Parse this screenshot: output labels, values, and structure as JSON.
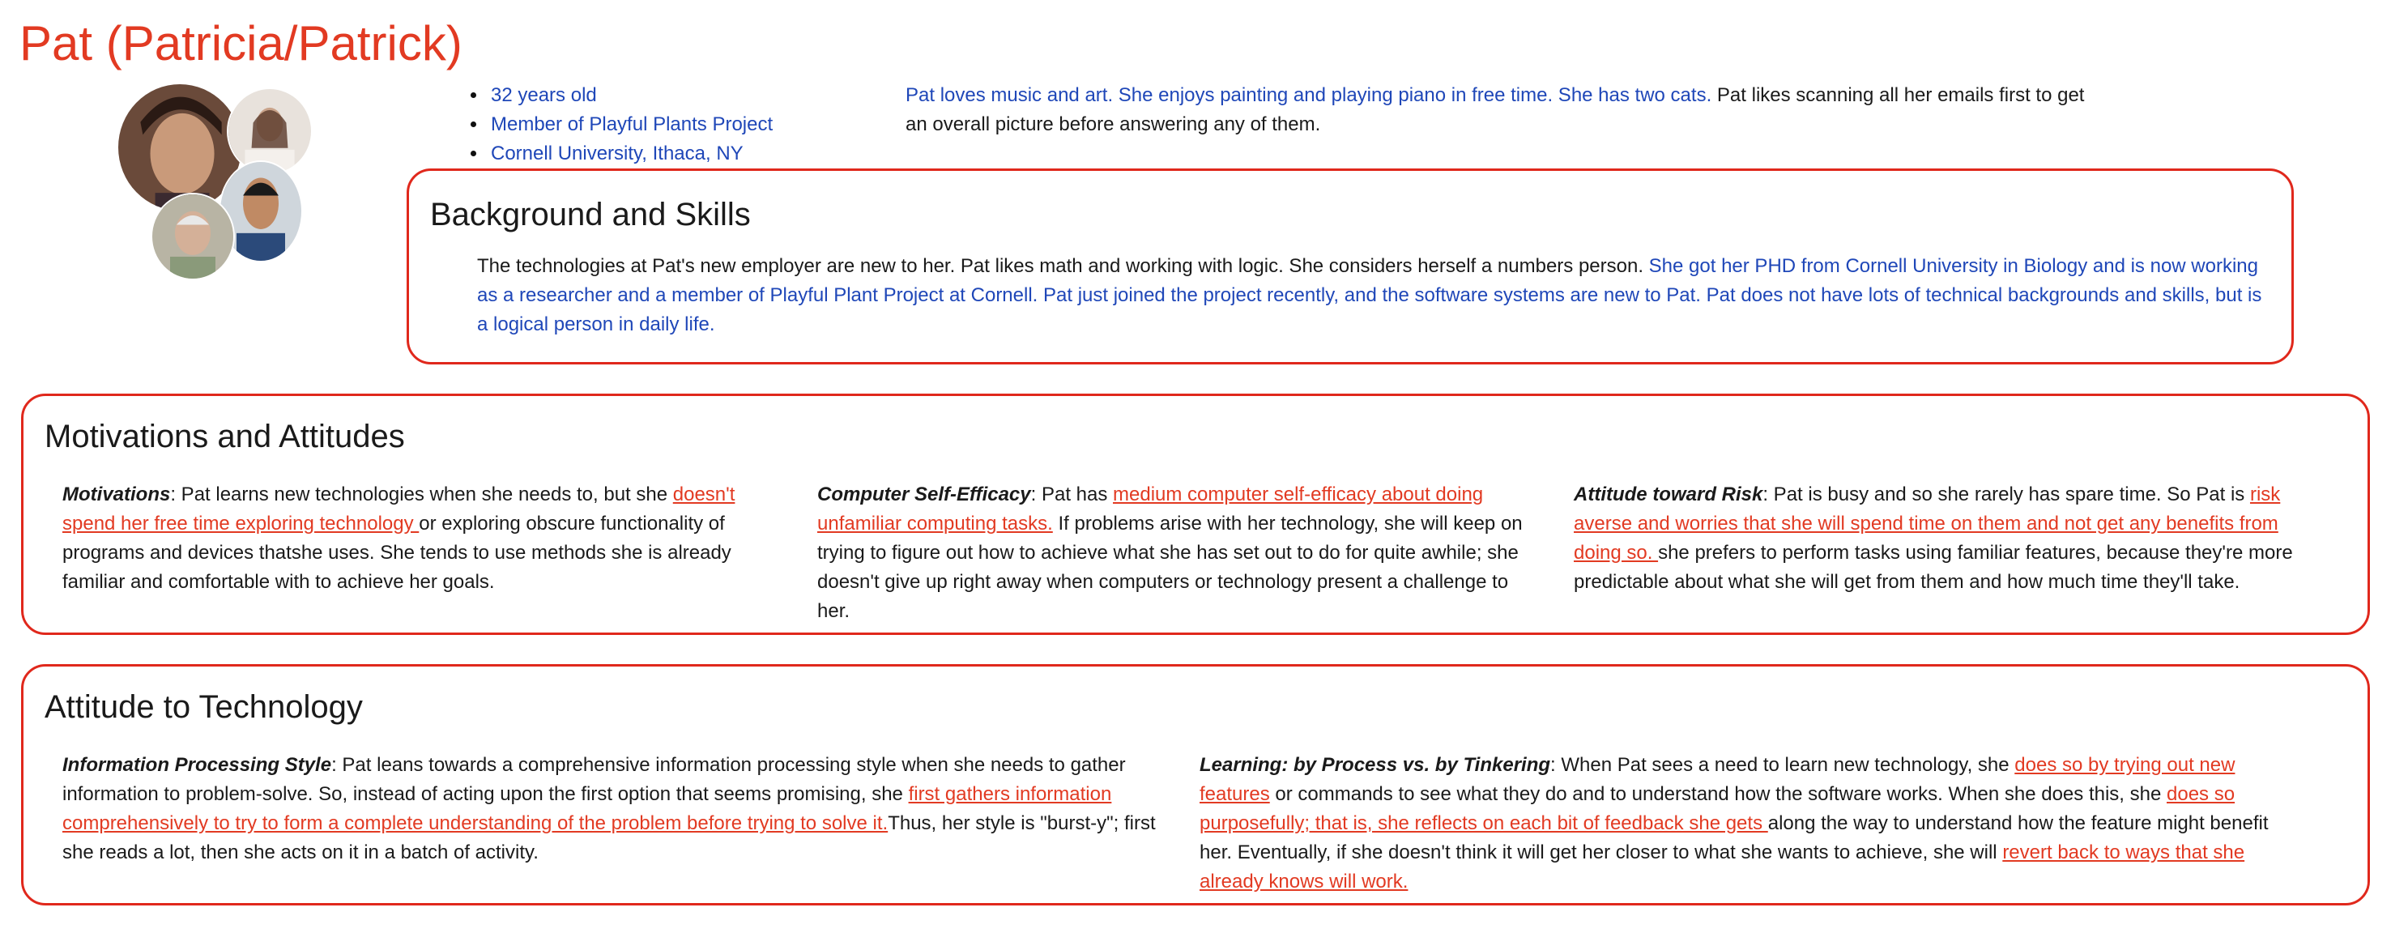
{
  "persona": {
    "name": "Pat (Patricia/Patrick)",
    "facts": [
      "32 years old",
      "Member of Playful Plants Project",
      "Cornell University, Ithaca, NY"
    ],
    "intro_blue": "Pat loves music and art. She enjoys painting and playing piano in free time. She has two cats.",
    "intro_rest": " Pat likes scanning all her emails first to get an overall picture before answering any of them."
  },
  "background": {
    "title": "Background and Skills",
    "text_plain": "The technologies at Pat's new employer are new to her. Pat likes math and working with logic. She considers herself a numbers person. ",
    "text_blue": "She got her PHD from Cornell University in Biology and is now working as a researcher and a member of Playful Plant Project at Cornell. Pat just joined the project recently, and the software systems are new to Pat. Pat does not have lots of technical backgrounds and skills, but is a logical person in daily life."
  },
  "motivations": {
    "title": "Motivations and Attitudes",
    "motivations": {
      "label": "Motivations",
      "a": ": Pat learns new technologies when she needs to, but she ",
      "link": "doesn't spend her free time exploring technology ",
      "b": "or exploring obscure functionality of programs and devices thatshe uses. She tends to use methods she is already familiar and comfortable with to achieve her goals."
    },
    "efficacy": {
      "label": "Computer Self-Efficacy",
      "a": ": Pat has ",
      "link": "medium computer self-efficacy about doing unfamiliar computing tasks.",
      "b": " If problems arise with her technology, she will keep on trying to figure out how to achieve what she has set out to do for quite awhile; she doesn't give up right away when computers or technology present a challenge to her."
    },
    "risk": {
      "label": "Attitude toward Risk",
      "a": ": Pat is busy and so she rarely has spare time. So Pat is ",
      "link": "risk averse and worries that she will spend time on them and not get any benefits from doing so. ",
      "b": "she prefers to perform tasks using familiar features, because they're more predictable about what she will get from them and how much time they'll take."
    }
  },
  "technology": {
    "title": "Attitude to Technology",
    "info": {
      "label": "Information Processing Style",
      "a": ": Pat leans towards a comprehensive information processing style when she needs to gather information to problem-solve. So, instead of acting upon the first option that seems promising, she ",
      "link": "first gathers information comprehensively to try to form a complete understanding of the problem before trying to solve it.",
      "b": "Thus, her style is \"burst-y\"; first she reads a lot, then she acts on it in a batch of activity."
    },
    "learning": {
      "label": "Learning: by Process vs. by Tinkering",
      "a": ": When Pat sees a need to learn new technology, she ",
      "link1": "does so by trying out new features",
      "b": " or commands to see what they do and to understand how the software works. When she does this, she ",
      "link2": "does so purposefully; that is, she reflects on each bit of feedback she gets ",
      "c": "along the way to understand how the feature might benefit her. Eventually, if she doesn't think it will get her closer to what she wants to achieve, she will ",
      "link3": "revert back to ways that she already knows will work."
    }
  }
}
